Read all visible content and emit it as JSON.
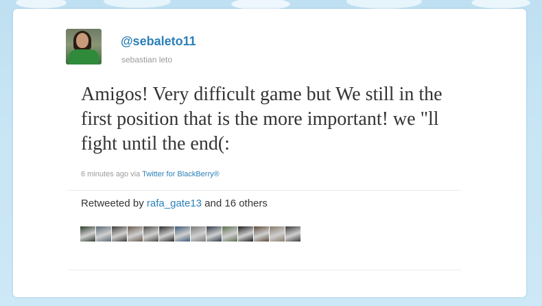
{
  "tweet": {
    "username": "@sebaleto11",
    "fullname": "sebastian leto",
    "text": "Amigos! Very difficult game but We still in the first position that is the more important! we \"ll fight until the end(:",
    "timestamp": "6 minutes ago",
    "via_prefix": "via",
    "via_client": "Twitter for BlackBerry®"
  },
  "retweets": {
    "prefix": "Retweeted by",
    "user": "rafa_gate13",
    "suffix": "and 16 others",
    "avatar_colors": [
      "#2e3b2c",
      "#5a6a74",
      "#3d3a35",
      "#6b5a4c",
      "#4a4a44",
      "#2a2a2a",
      "#3c5a78",
      "#7a7a7a",
      "#2f3b47",
      "#5b6e4f",
      "#1e1e1e",
      "#5d4a3a",
      "#8a7b6a",
      "#3a3a3a"
    ]
  },
  "colors": {
    "link": "#2a7fb8",
    "background": "#c7e5f4"
  }
}
